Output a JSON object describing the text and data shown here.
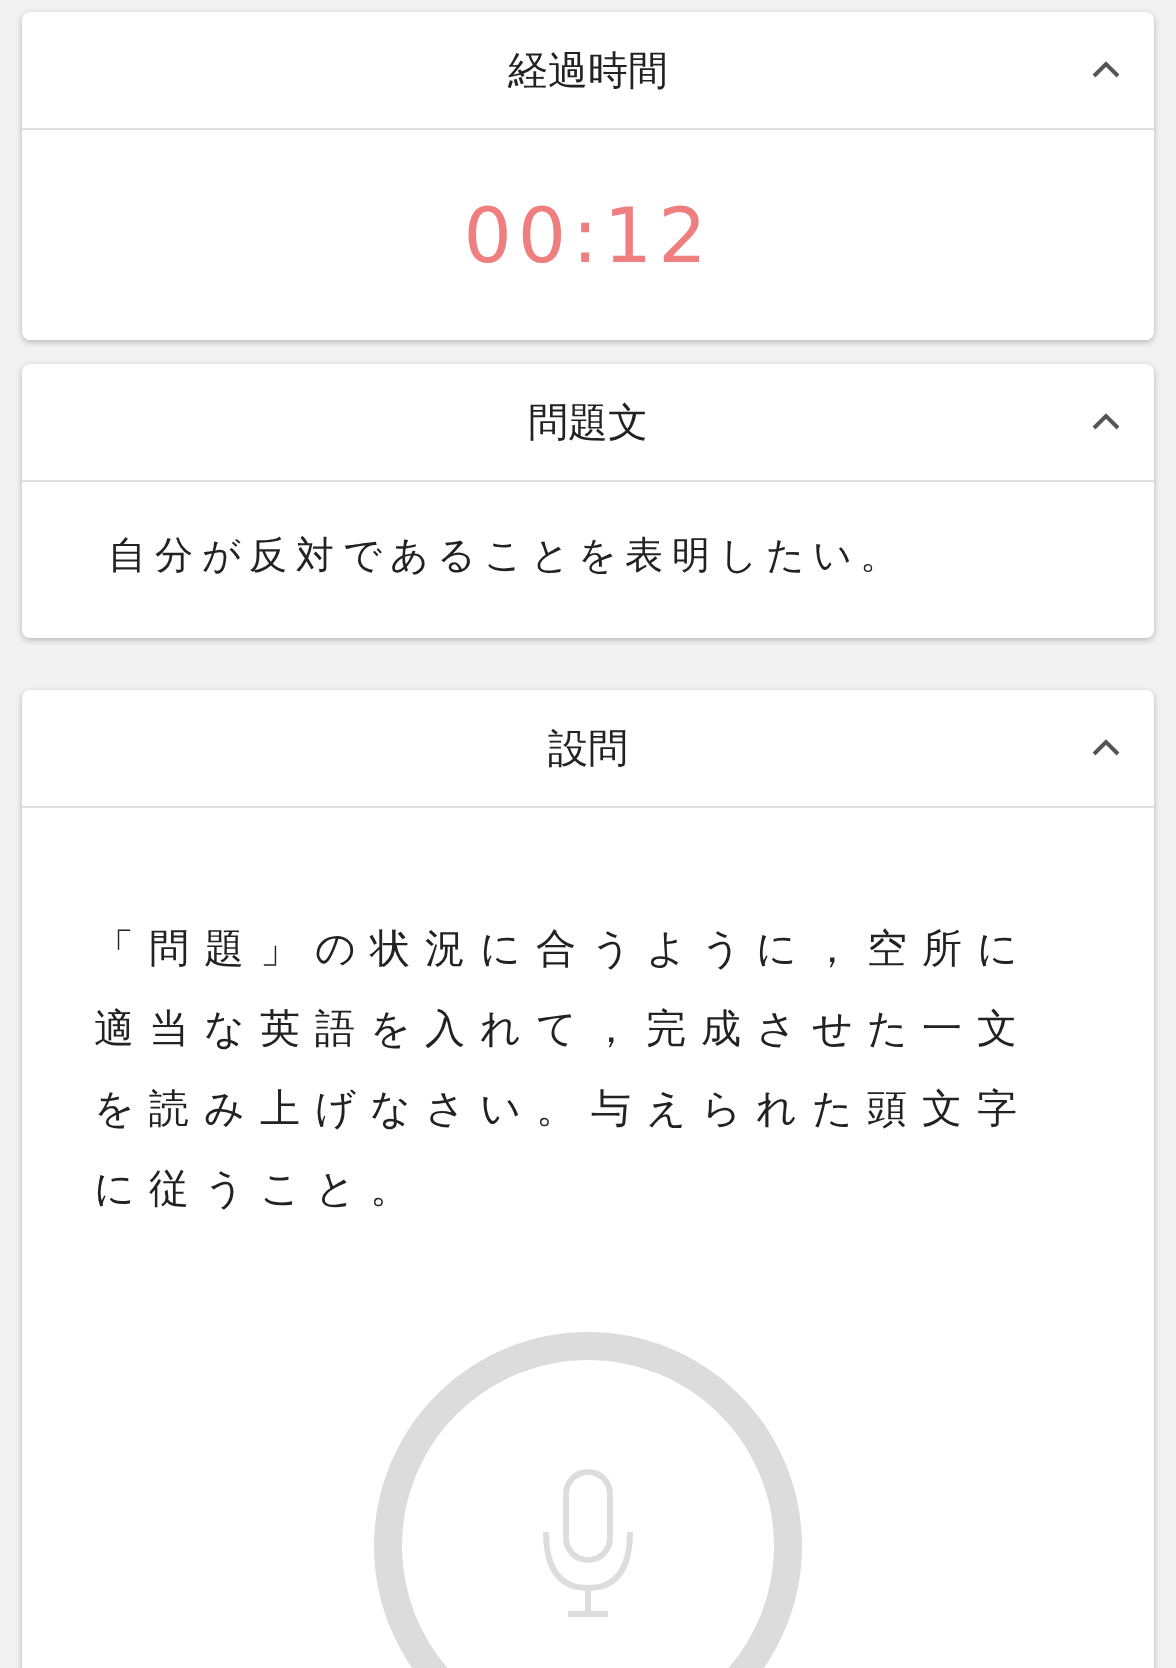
{
  "panels": [
    {
      "kind": "timer",
      "title": "経過時間",
      "expanded": true,
      "time": "00:12"
    },
    {
      "kind": "text",
      "title": "問題文",
      "expanded": true,
      "text": "自分が反対であることを表明したい。"
    },
    {
      "kind": "question",
      "title": "設問",
      "expanded": true,
      "text": "「問題」の状況に合うように，空所に適当な英語を入れて，完成させた一文を読み上げなさい。与えられた頭文字に従うこと。"
    }
  ]
}
